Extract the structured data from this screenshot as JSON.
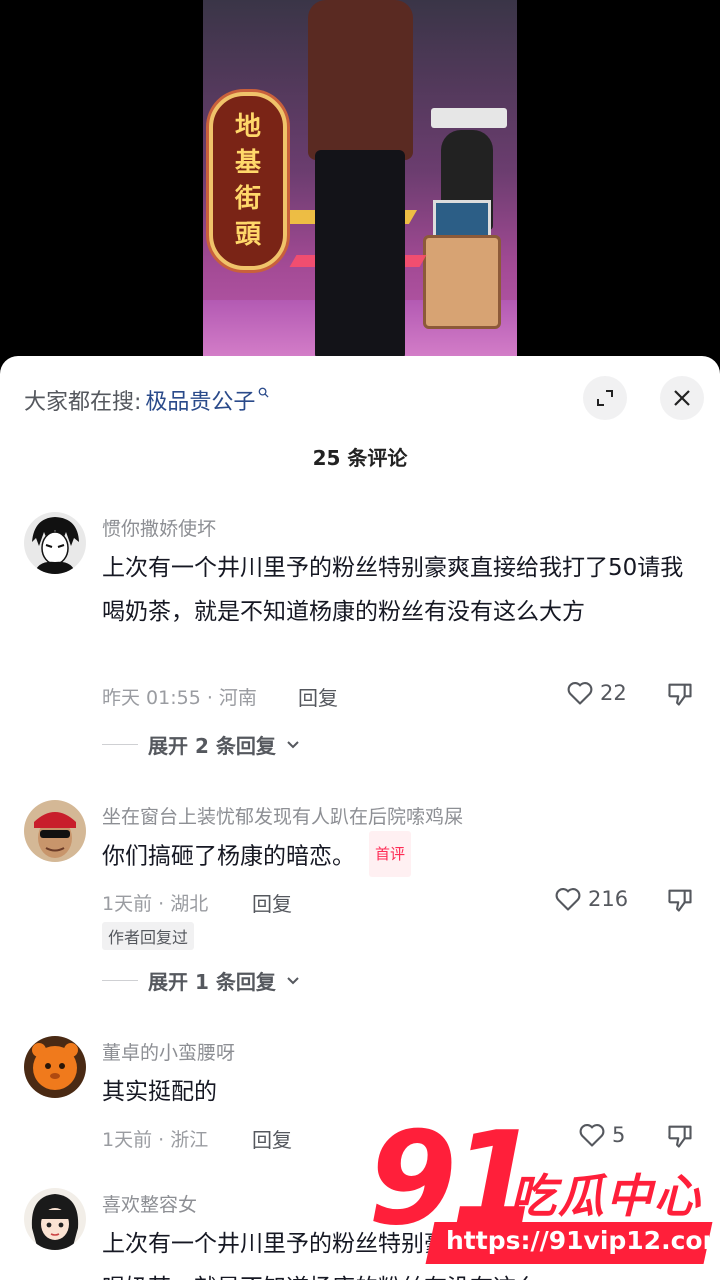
{
  "video": {
    "sign_chars": [
      "地",
      "基",
      "街",
      "頭"
    ]
  },
  "search": {
    "prefix": "大家都在搜:",
    "term": "极品贵公子"
  },
  "header": {
    "comment_count": "25 条评论"
  },
  "comments": [
    {
      "username": "惯你撒娇使坏",
      "text": "上次有一个井川里予的粉丝特别豪爽直接给我打了50请我喝奶茶，就是不知道杨康的粉丝有没有这么大方",
      "time_location": "昨天 01:55 · 河南",
      "reply_label": "回复",
      "likes": "22",
      "expand_label": "展开 2 条回复"
    },
    {
      "username": "坐在窗台上装忧郁发现有人趴在后院嗦鸡屎",
      "text": "你们搞砸了杨康的暗恋。",
      "badge": "首评",
      "time_location": "1天前 · 湖北",
      "reply_label": "回复",
      "likes": "216",
      "author_tag": "作者回复过",
      "expand_label": "展开 1 条回复"
    },
    {
      "username": "董卓的小蛮腰呀",
      "text": "其实挺配的",
      "time_location": "1天前 · 浙江",
      "reply_label": "回复",
      "likes": "5"
    },
    {
      "username": "喜欢整容女",
      "text": "上次有一个井川里予的粉丝特别豪爽直接给我打了50请我喝奶茶，就是不知道杨康的粉丝有没有这么"
    }
  ],
  "watermark": {
    "number": "91",
    "text": "吃瓜中心",
    "url": "https://91vip12.com"
  },
  "colors": {
    "accent": "#fe2c55",
    "search_term": "#2a4a8a",
    "watermark": "#ff1f3a"
  },
  "icons": [
    "search-icon",
    "expand-icon",
    "close-icon",
    "heart-icon",
    "dislike-icon",
    "chevron-down-icon"
  ]
}
